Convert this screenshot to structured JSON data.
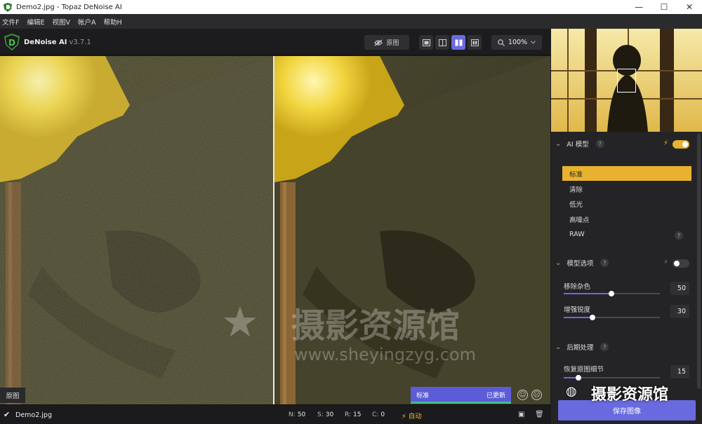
{
  "window": {
    "title": "Demo2.jpg - Topaz DeNoise AI",
    "controls": [
      "minimize-icon",
      "maximize-icon",
      "close-icon"
    ]
  },
  "menu": [
    {
      "label": "文件F"
    },
    {
      "label": "编辑E"
    },
    {
      "label": "视图V"
    },
    {
      "label": "帐户A"
    },
    {
      "label": "帮助H"
    }
  ],
  "app": {
    "name": "DeNoise AI",
    "version": "v3.7.1"
  },
  "toolbar": {
    "original_label": "原图",
    "zoom": "100%",
    "active_view": "split-side-by-side"
  },
  "canvas": {
    "left_tag": "原图",
    "status_model": "标准",
    "status_state": "已更新"
  },
  "watermark": {
    "title": "摄影资源馆",
    "url": "www.sheyingzyg.com",
    "corner": "摄影资源馆"
  },
  "bottom": {
    "filename": "Demo2.jpg",
    "stats": [
      {
        "k": "N:",
        "v": "50"
      },
      {
        "k": "S:",
        "v": "30"
      },
      {
        "k": "R:",
        "v": "15"
      },
      {
        "k": "C:",
        "v": "0"
      }
    ],
    "auto": "自动"
  },
  "panel": {
    "ai_model": {
      "title": "AI 模型",
      "enabled": true,
      "options": [
        {
          "label": "标准",
          "selected": true
        },
        {
          "label": "清除"
        },
        {
          "label": "低光"
        },
        {
          "label": "高噪点"
        },
        {
          "label": "RAW"
        }
      ]
    },
    "model_options": {
      "title": "模型选项",
      "enabled": false,
      "sliders": [
        {
          "label": "移除杂色",
          "value": 50
        },
        {
          "label": "增强锐度",
          "value": 30
        }
      ]
    },
    "post": {
      "title": "后期处理",
      "sliders": [
        {
          "label": "恢复原图细节",
          "value": 15
        }
      ]
    },
    "save_label": "保存图像"
  },
  "colors": {
    "accent": "#6a6ae0",
    "highlight": "#e8b230",
    "status_green": "#3fbf8a"
  }
}
